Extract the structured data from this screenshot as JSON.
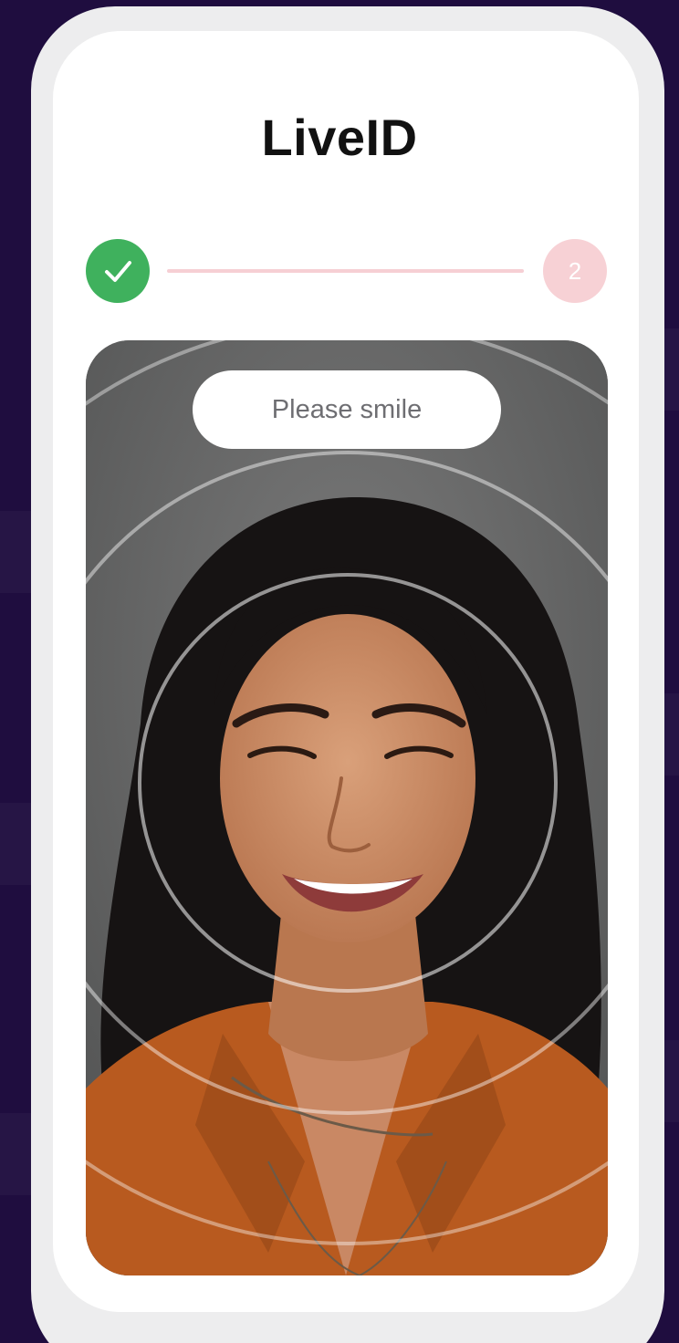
{
  "app": {
    "title": "LiveID"
  },
  "stepper": {
    "steps": [
      {
        "status": "complete",
        "icon": "checkmark-icon"
      },
      {
        "status": "current",
        "label": "2"
      }
    ],
    "colors": {
      "complete": "#3fb15d",
      "pending": "#f7d1d5",
      "line": "#f6cfd4"
    }
  },
  "camera": {
    "prompt": "Please smile",
    "overlay": "concentric-circles"
  },
  "colors": {
    "background": "#1f0d3f",
    "device_frame": "#ededee",
    "screen": "#ffffff"
  }
}
